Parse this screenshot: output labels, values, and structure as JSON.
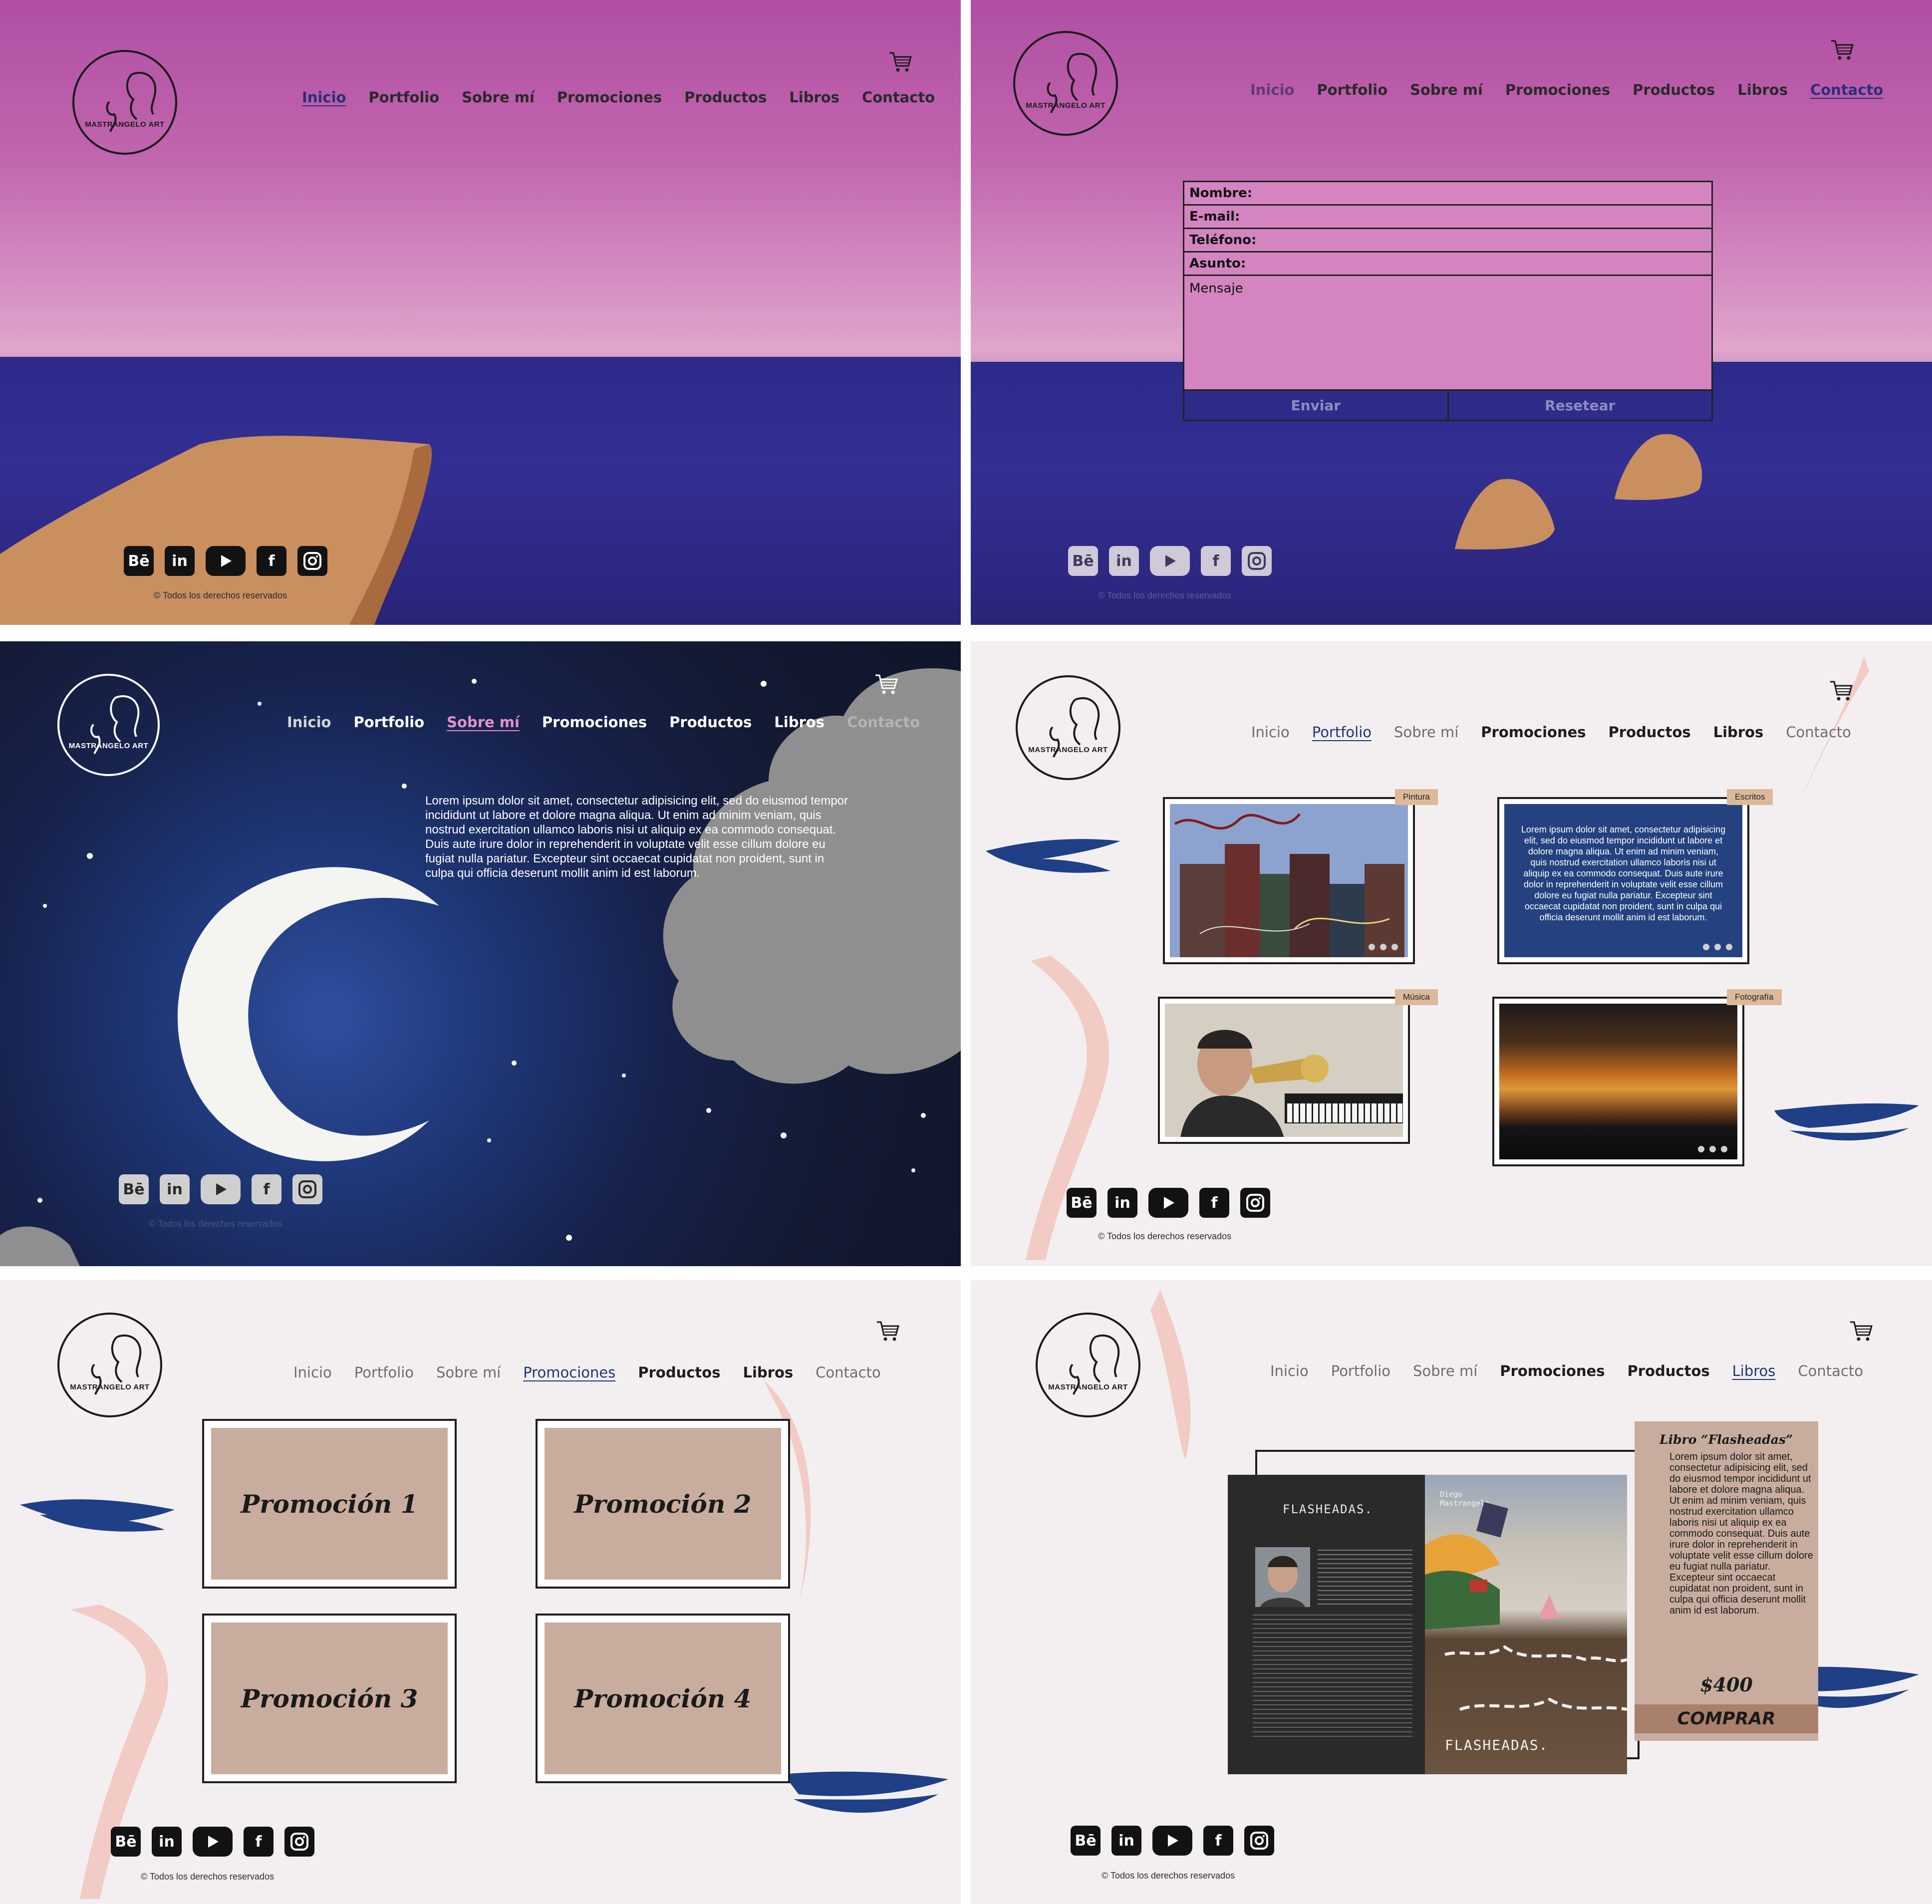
{
  "logo": {
    "text": "MASTRANGELO ART",
    "icon": "two-faces-line-art-icon"
  },
  "nav": [
    "Inicio",
    "Portfolio",
    "Sobre mí",
    "Promociones",
    "Productos",
    "Libros",
    "Contacto"
  ],
  "social": {
    "behance": "Bē",
    "icons": [
      "behance-icon",
      "linkedin-icon",
      "youtube-icon",
      "facebook-icon",
      "instagram-icon"
    ]
  },
  "copyright": "© Todos los derechos reservados",
  "contact": {
    "fields": [
      "Nombre:",
      "E-mail:",
      "Teléfono:",
      "Asunto:"
    ],
    "message": "Mensaje",
    "submit": "Enviar",
    "reset": "Resetear"
  },
  "about": {
    "text": "Lorem ipsum dolor sit amet, consectetur adipisicing elit, sed do eiusmod tempor incididunt ut labore et dolore magna aliqua. Ut enim ad minim veniam, quis nostrud exercitation ullamco laboris nisi ut aliquip ex ea commodo consequat. Duis aute irure dolor in reprehenderit in voluptate velit esse cillum dolore eu fugiat nulla pariatur. Excepteur sint occaecat cupidatat non proident, sunt in culpa qui officia deserunt mollit anim id est laborum."
  },
  "portfolio": {
    "tags": [
      "Pintura",
      "Escritos",
      "Música",
      "Fotografía"
    ],
    "writing": "Lorem ipsum dolor sit amet, consectetur adipisicing elit, sed do eiusmod tempor incididunt ut labore et dolore magna aliqua. Ut enim ad minim veniam, quis nostrud exercitation ullamco laboris nisi ut aliquip ex ea commodo consequat. Duis aute irure dolor in reprehenderit in voluptate velit esse cillum dolore eu fugiat nulla pariatur. Excepteur sint occaecat cupidatat non proident, sunt in culpa qui officia deserunt mollit anim id est laborum."
  },
  "promos": [
    "Promoción 1",
    "Promoción 2",
    "Promoción 3",
    "Promoción 4"
  ],
  "book": {
    "title": "Libro “Flasheadas”",
    "description": "Lorem ipsum dolor sit amet, consectetur adipisicing elit, sed do eiusmod tempor incididunt ut labore et dolore magna aliqua. Ut enim ad minim veniam, quis nostrud exercitation ullamco laboris nisi ut aliquip ex ea commodo consequat. Duis aute irure dolor in reprehenderit in voluptate velit esse cillum dolore eu fugiat nulla pariatur. Excepteur sint occaecat cupidatat non proident, sunt in culpa qui officia deserunt mollit anim id est laborum.",
    "price": "$400",
    "buy": "COMPRAR",
    "cover_title": "FLASHEADAS.",
    "author": "Diego Mastrangelo"
  },
  "colors": {
    "accent": "#21366f",
    "tag": "#dcb99a",
    "promo": "#c8ad9e",
    "buy": "#a9806b",
    "brush_blue": "#1f3f86",
    "brush_pink": "#f2c6bf"
  }
}
